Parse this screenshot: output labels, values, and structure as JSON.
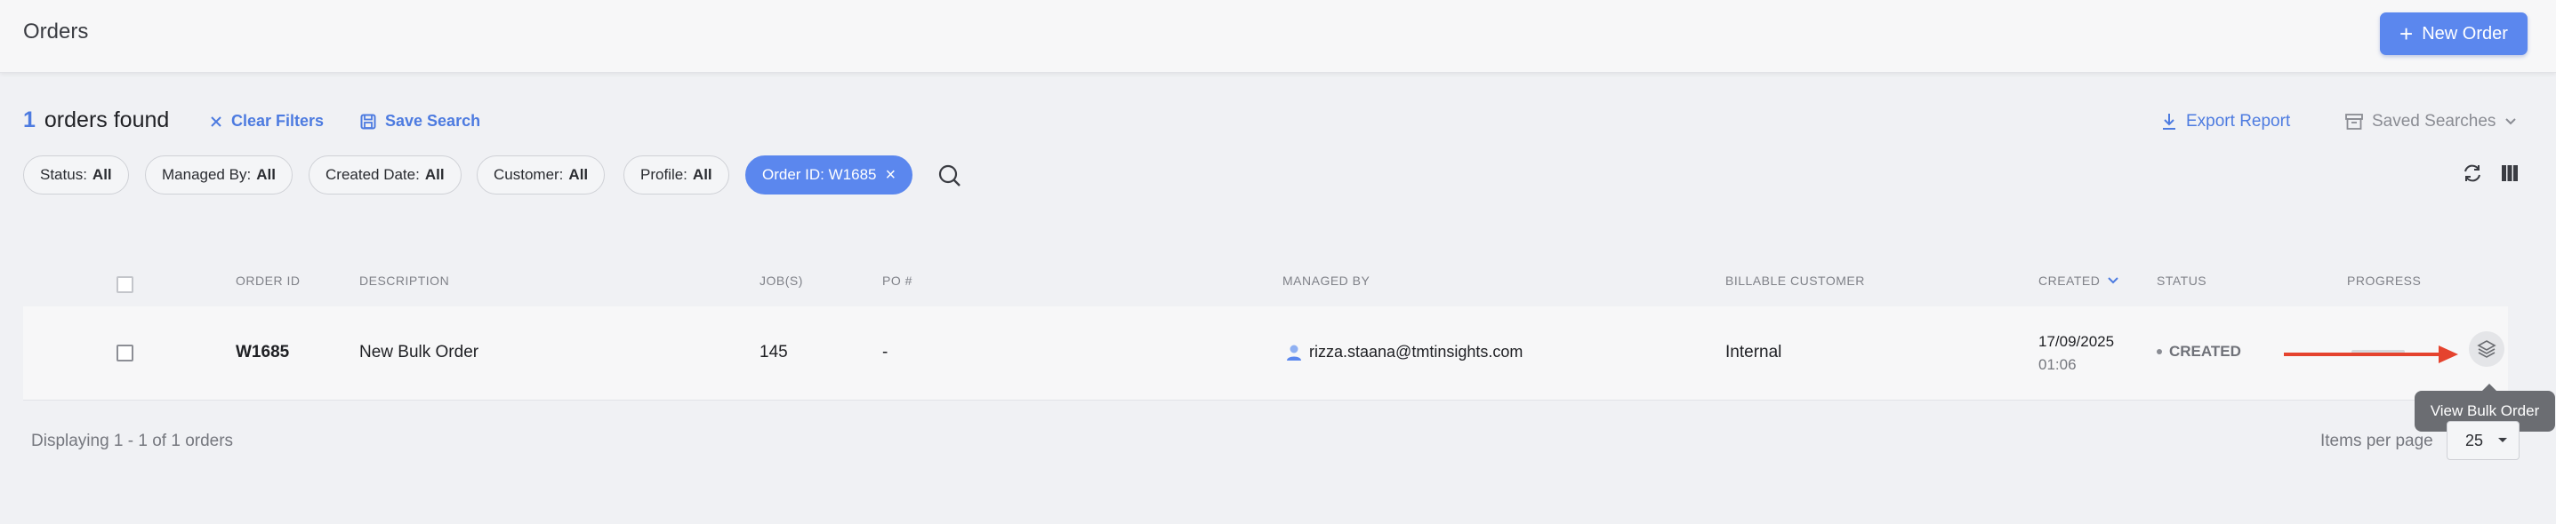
{
  "header": {
    "title": "Orders",
    "new_order_label": "New Order"
  },
  "summary": {
    "count": "1",
    "found_text": "orders found",
    "clear_filters": "Clear Filters",
    "save_search": "Save Search",
    "export_report": "Export Report",
    "saved_searches": "Saved Searches"
  },
  "filters": [
    {
      "label": "Status:",
      "value": "All"
    },
    {
      "label": "Managed By:",
      "value": "All"
    },
    {
      "label": "Created Date:",
      "value": "All"
    },
    {
      "label": "Customer:",
      "value": "All"
    },
    {
      "label": "Profile:",
      "value": "All"
    }
  ],
  "active_filter": "Order ID: W1685",
  "table": {
    "headers": {
      "order_id": "ORDER ID",
      "description": "DESCRIPTION",
      "jobs": "JOB(S)",
      "po": "PO #",
      "managed_by": "MANAGED BY",
      "billable_customer": "BILLABLE CUSTOMER",
      "created": "CREATED",
      "status": "STATUS",
      "progress": "PROGRESS"
    },
    "rows": [
      {
        "order_id": "W1685",
        "description": "New Bulk Order",
        "jobs": "145",
        "po": "-",
        "managed_by": "rizza.staana@tmtinsights.com",
        "billable_customer": "Internal",
        "created_date": "17/09/2025",
        "created_time": "01:06",
        "status": "CREATED"
      }
    ]
  },
  "tooltip": "View Bulk Order",
  "footer": {
    "displaying": "Displaying 1 - 1 of 1 orders",
    "items_per_page_label": "Items per page",
    "items_per_page_value": "25"
  },
  "colors": {
    "accent": "#5b87ee",
    "annotation_arrow": "#e5432e"
  }
}
